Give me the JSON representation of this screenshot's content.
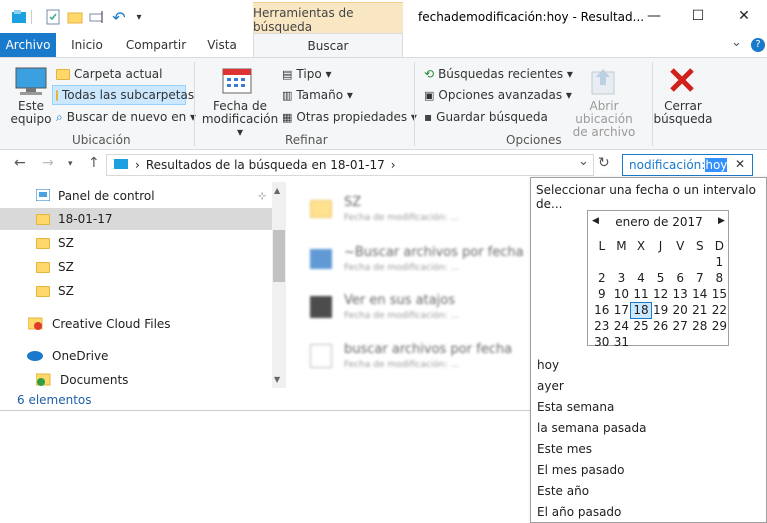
{
  "window": {
    "title": "fechademodificación:hoy - Resultad...",
    "context_tab": "Herramientas de búsqueda",
    "min": "—",
    "max": "☐",
    "close": "✕"
  },
  "tabs": {
    "file": "Archivo",
    "items": [
      "Inicio",
      "Compartir",
      "Vista"
    ],
    "active": "Buscar",
    "chevron": "⌄",
    "help": "?"
  },
  "ribbon": {
    "este_equipo": "Este\nequipo",
    "carpeta_actual": "Carpeta actual",
    "todas_subcarpetas": "Todas las subcarpetas",
    "buscar_nuevo": "Buscar de nuevo en ▾",
    "ubicacion_label": "Ubicación",
    "fecha_mod": "Fecha de\nmodificación ▾",
    "tipo": "Tipo ▾",
    "tamano": "Tamaño ▾",
    "otras": "Otras propiedades ▾",
    "refinar_label": "Refinar",
    "recientes": "Búsquedas recientes ▾",
    "avanzadas": "Opciones avanzadas ▾",
    "guardar": "Guardar búsqueda",
    "abrir_ubicacion": "Abrir ubicación\nde archivo",
    "cerrar_busqueda": "Cerrar\nbúsqueda",
    "opciones_label": "Opciones"
  },
  "address": {
    "path_prefix": "›",
    "path": "Resultados de la búsqueda en 18-01-17",
    "path_suffix": "›",
    "dropdown": "⌄",
    "refresh": "↻"
  },
  "search": {
    "query_prefix": "nodificación:",
    "query_highlight": "hoy",
    "clear": "✕"
  },
  "nav": {
    "items": [
      "Panel de control",
      "18-01-17",
      "SZ",
      "SZ",
      "SZ",
      "Creative Cloud Files",
      "OneDrive",
      "Documents"
    ],
    "pin": "📌"
  },
  "status": {
    "count": "6 elementos"
  },
  "results": [
    {
      "title": "SZ",
      "sub": "Fecha de modificación: ..."
    },
    {
      "title": "~Buscar archivos por fecha",
      "sub": "Fecha de modificación: ..."
    },
    {
      "title": "Ver en sus atajos",
      "sub": "Fecha de modificación: ..."
    },
    {
      "title": "buscar archivos por fecha",
      "sub": "Fecha de modificación: ..."
    }
  ],
  "popup": {
    "header": "Seleccionar una fecha o un intervalo de...",
    "month": "enero de 2017",
    "prev": "◀",
    "next": "▶",
    "weekdays": [
      "L",
      "M",
      "X",
      "J",
      "V",
      "S",
      "D"
    ],
    "days": [
      "",
      "",
      "",
      "",
      "",
      "",
      "1",
      "2",
      "3",
      "4",
      "5",
      "6",
      "7",
      "8",
      "9",
      "10",
      "11",
      "12",
      "13",
      "14",
      "15",
      "16",
      "17",
      "18",
      "19",
      "20",
      "21",
      "22",
      "23",
      "24",
      "25",
      "26",
      "27",
      "28",
      "29",
      "30",
      "31"
    ],
    "today": "18",
    "options": [
      "hoy",
      "ayer",
      "Esta semana",
      "la semana pasada",
      "Este mes",
      "El mes pasado",
      "Este año",
      "El año pasado"
    ]
  },
  "colors": {
    "accent": "#1979ca",
    "context_tab": "#f9e7c4",
    "selection": "#cce8ff",
    "close_red": "#d0201a"
  }
}
